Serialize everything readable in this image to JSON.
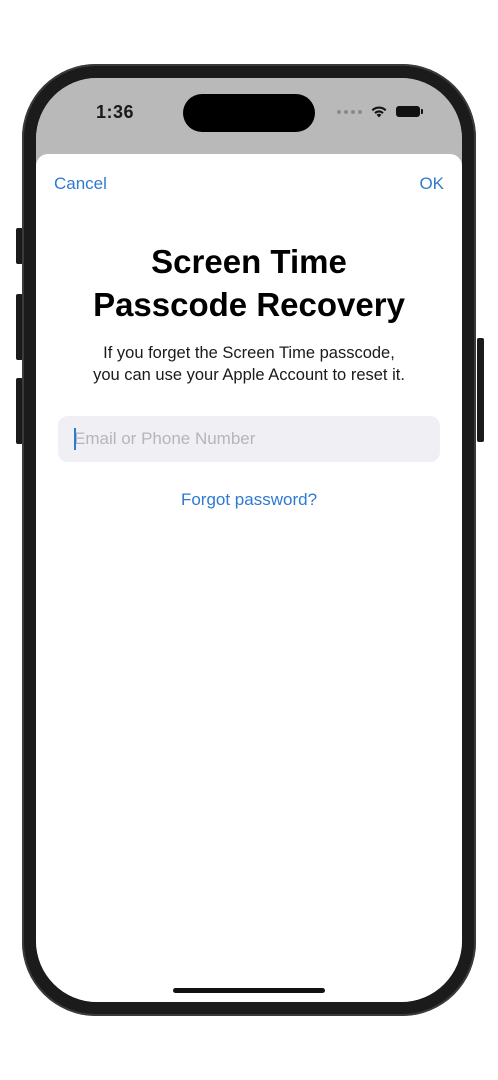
{
  "status_bar": {
    "time": "1:36"
  },
  "icons": {
    "signal": "signal-dots-icon",
    "wifi": "wifi-icon",
    "battery": "battery-icon"
  },
  "nav": {
    "cancel_label": "Cancel",
    "ok_label": "OK"
  },
  "content": {
    "title_line1": "Screen Time",
    "title_line2": "Passcode Recovery",
    "subtitle_line1": "If you forget the Screen Time passcode,",
    "subtitle_line2": "you can use your Apple Account to reset it.",
    "account_input": {
      "value": "",
      "placeholder": "Email or Phone Number"
    },
    "forgot_label": "Forgot password?"
  },
  "colors": {
    "accent": "#2f7ad0",
    "field_background": "#efeff4",
    "status_bar_background": "#b9b9b9"
  }
}
